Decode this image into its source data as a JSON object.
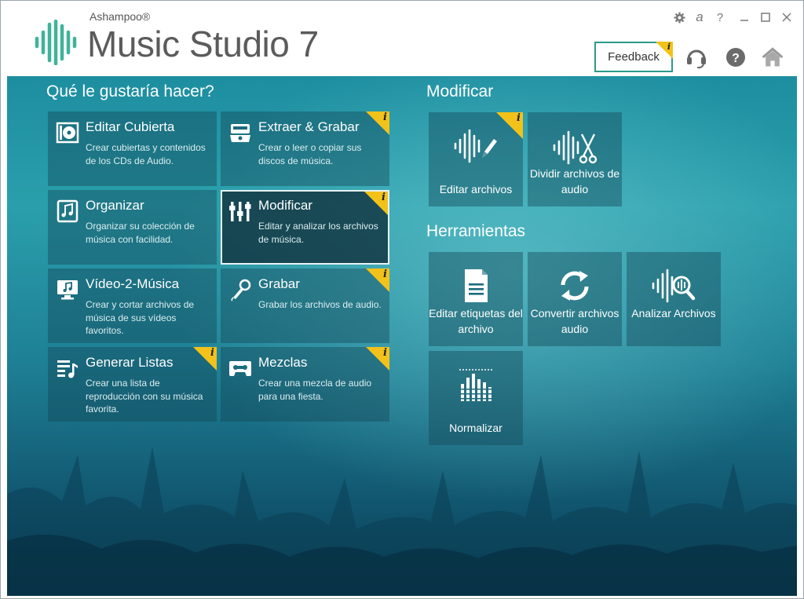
{
  "header": {
    "brand_small": "Ashampoo®",
    "brand_big": "Music Studio 7",
    "feedback_label": "Feedback",
    "info_marker": "i",
    "language_glyph": "a",
    "question_glyph": "?",
    "icons": [
      "settings-icon",
      "language-icon",
      "help-small-icon",
      "minimize-icon",
      "maximize-icon",
      "close-icon",
      "support-headset-icon",
      "help-icon",
      "home-icon"
    ]
  },
  "left": {
    "title": "Qué le gustaría hacer?",
    "tiles": [
      {
        "title": "Editar Cubierta",
        "desc": "Crear cubiertas y contenidos de los CDs de Audio.",
        "icon": "cd-cover-icon",
        "info": false
      },
      {
        "title": "Extraer & Grabar",
        "desc": "Crear o leer o copiar sus discos de música.",
        "icon": "disc-burn-icon",
        "info": true
      },
      {
        "title": "Organizar",
        "desc": "Organizar su colección de música con facilidad.",
        "icon": "music-library-icon",
        "info": false
      },
      {
        "title": "Modificar",
        "desc": "Editar y analizar los archivos de música.",
        "icon": "mixer-sliders-icon",
        "info": true
      },
      {
        "title": "Vídeo-2-Música",
        "desc": "Crear y cortar archivos de música de sus vídeos favoritos.",
        "icon": "video-music-icon",
        "info": false
      },
      {
        "title": "Grabar",
        "desc": "Grabar los archivos de audio.",
        "icon": "microphone-icon",
        "info": true
      },
      {
        "title": "Generar Listas",
        "desc": "Crear una lista de reproducción con su música favorita.",
        "icon": "playlist-icon",
        "info": true
      },
      {
        "title": "Mezclas",
        "desc": "Crear una mezcla de audio para una fiesta.",
        "icon": "cassette-icon",
        "info": true
      }
    ]
  },
  "right": {
    "modify_title": "Modificar",
    "modify_items": [
      {
        "label": "Editar archivos",
        "icon": "wave-edit-icon",
        "info": true
      },
      {
        "label": "Dividir archivos de audio",
        "icon": "wave-cut-icon",
        "info": false
      }
    ],
    "tools_title": "Herramientas",
    "tools_items": [
      {
        "label": "Editar etiquetas del archivo",
        "icon": "document-tags-icon"
      },
      {
        "label": "Convertir archivos audio",
        "icon": "convert-arrows-icon"
      },
      {
        "label": "Analizar Archivos",
        "icon": "wave-analyze-icon"
      },
      {
        "label": "Normalizar",
        "icon": "equalizer-bars-icon"
      }
    ]
  },
  "colors": {
    "accent_teal": "#2c9a8a",
    "info_yellow": "#f2c21a",
    "logo_green": "#3fb39a"
  }
}
